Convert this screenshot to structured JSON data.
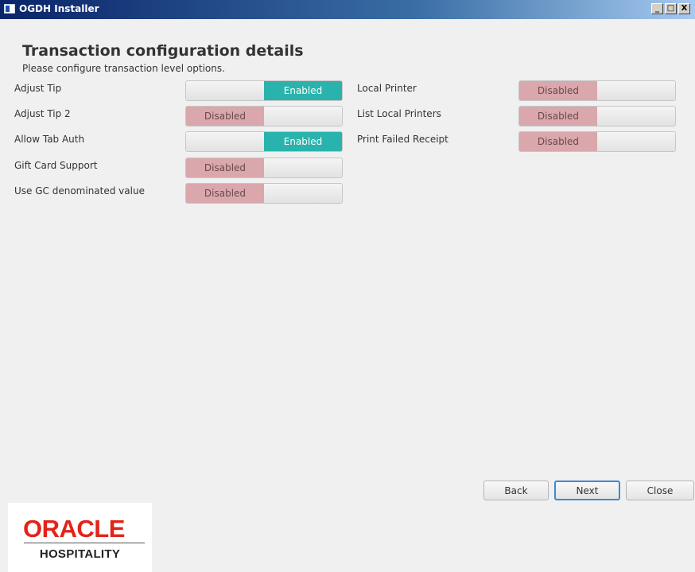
{
  "window": {
    "title": "OGDH Installer",
    "controls": [
      "_",
      "□",
      "X"
    ]
  },
  "header": {
    "title": "Transaction configuration details",
    "subtitle": "Please configure transaction level options."
  },
  "options": [
    {
      "label": "Adjust Tip",
      "state": "Enabled"
    },
    {
      "label": "Adjust Tip 2",
      "state": "Disabled"
    },
    {
      "label": "Allow Tab Auth",
      "state": "Enabled"
    },
    {
      "label": "Gift Card Support",
      "state": "Disabled"
    },
    {
      "label": "Use GC denominated value",
      "state": "Disabled"
    },
    {
      "label": "Local Printer",
      "state": "Disabled"
    },
    {
      "label": "List Local Printers",
      "state": "Disabled"
    },
    {
      "label": "Print Failed Receipt",
      "state": "Disabled"
    }
  ],
  "buttons": {
    "back": "Back",
    "next": "Next",
    "close": "Close"
  },
  "logo": {
    "brand": "ORACLE",
    "product": "HOSPITALITY"
  },
  "colors": {
    "enabled": "#2ab3ac",
    "disabled": "#d9a7ac",
    "title_bar": "#0a246a"
  }
}
